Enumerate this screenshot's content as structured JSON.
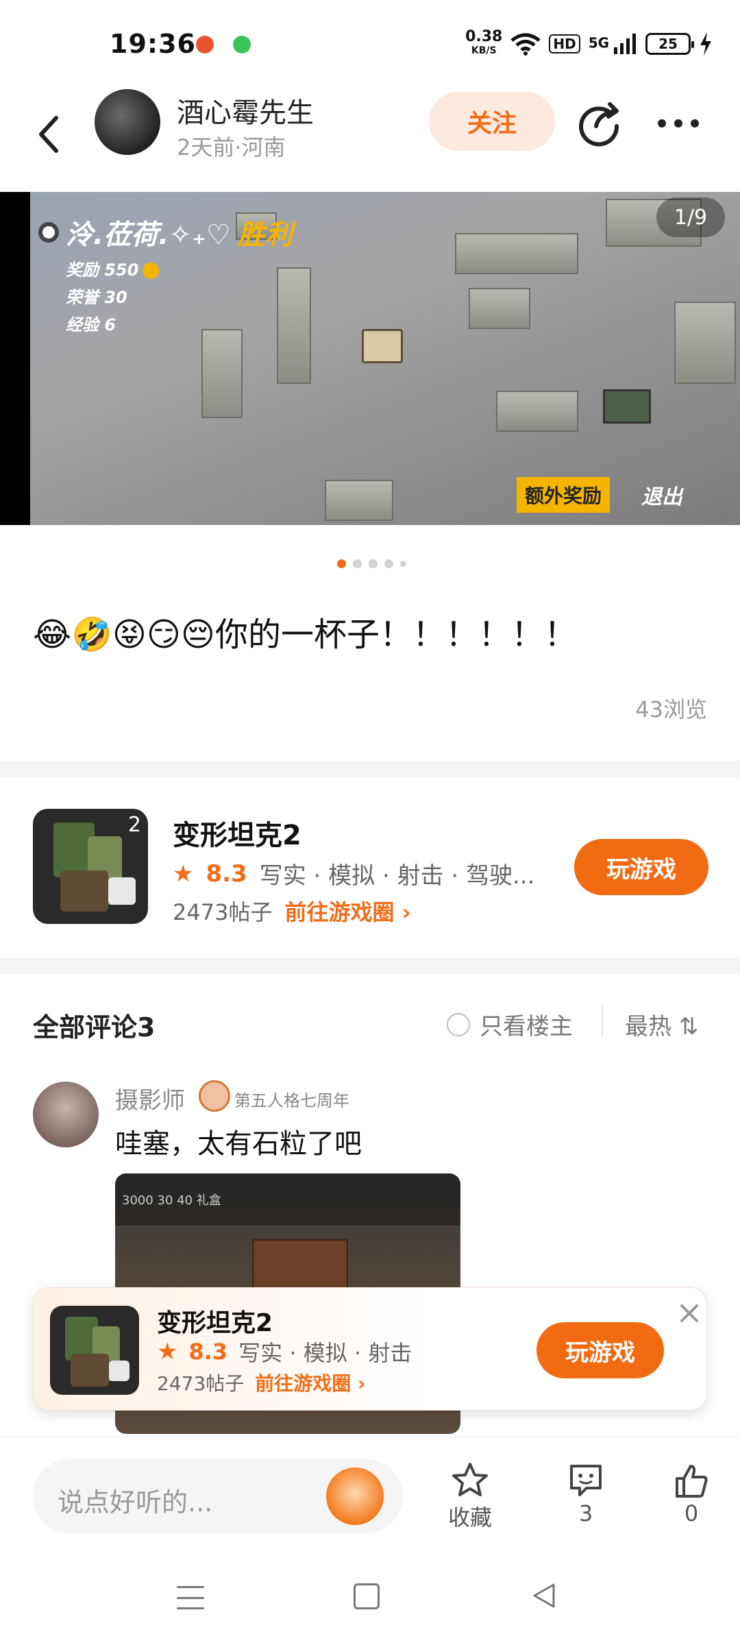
{
  "status_bar": {
    "time": "19:36",
    "net_speed": "0.38",
    "net_unit": "KB/S",
    "hd": "HD",
    "signal": "5G",
    "battery": "25"
  },
  "header": {
    "author": "酒心霉先生",
    "meta": "2天前·河南",
    "follow_label": "关注"
  },
  "hero": {
    "counter": "1/9",
    "player_name": "泠.莅荷.✧₊♡",
    "result": "胜利",
    "stat_reward": "奖励 550",
    "stat_honor": "荣誉 30",
    "stat_exp": "经验 6",
    "extra_reward": "额外奖励",
    "quit": "退出"
  },
  "post": {
    "text": "😂🤣😝😏😔你的一杯子！！！！！！",
    "views": "43浏览"
  },
  "game": {
    "name": "变形坦克2",
    "rating": "8.3",
    "tags": "写实 · 模拟 · 射击 · 驾驶...",
    "posts": "2473帖子",
    "circle_link": "前往游戏圈 ›",
    "play_label": "玩游戏"
  },
  "comments": {
    "title": "全部评论3",
    "only_host": "只看楼主",
    "sort": "最热 ⇅",
    "items": [
      {
        "name": "摄影师",
        "badge": "第五人格七周年",
        "text": "哇塞，太有石粒了吧",
        "image_bar": "3000   30   40   礼盒"
      }
    ]
  },
  "floating_card": {
    "name": "变形坦克2",
    "rating": "8.3",
    "tags": "写实 · 模拟 · 射击",
    "posts": "2473帖子",
    "circle_link": "前往游戏圈 ›",
    "play_label": "玩游戏"
  },
  "bottom_bar": {
    "input_placeholder": "说点好听的...",
    "collect_label": "收藏",
    "comment_count": "3",
    "like_count": "0"
  },
  "colors": {
    "accent": "#f26b12",
    "follow_bg": "#fde9dd"
  }
}
